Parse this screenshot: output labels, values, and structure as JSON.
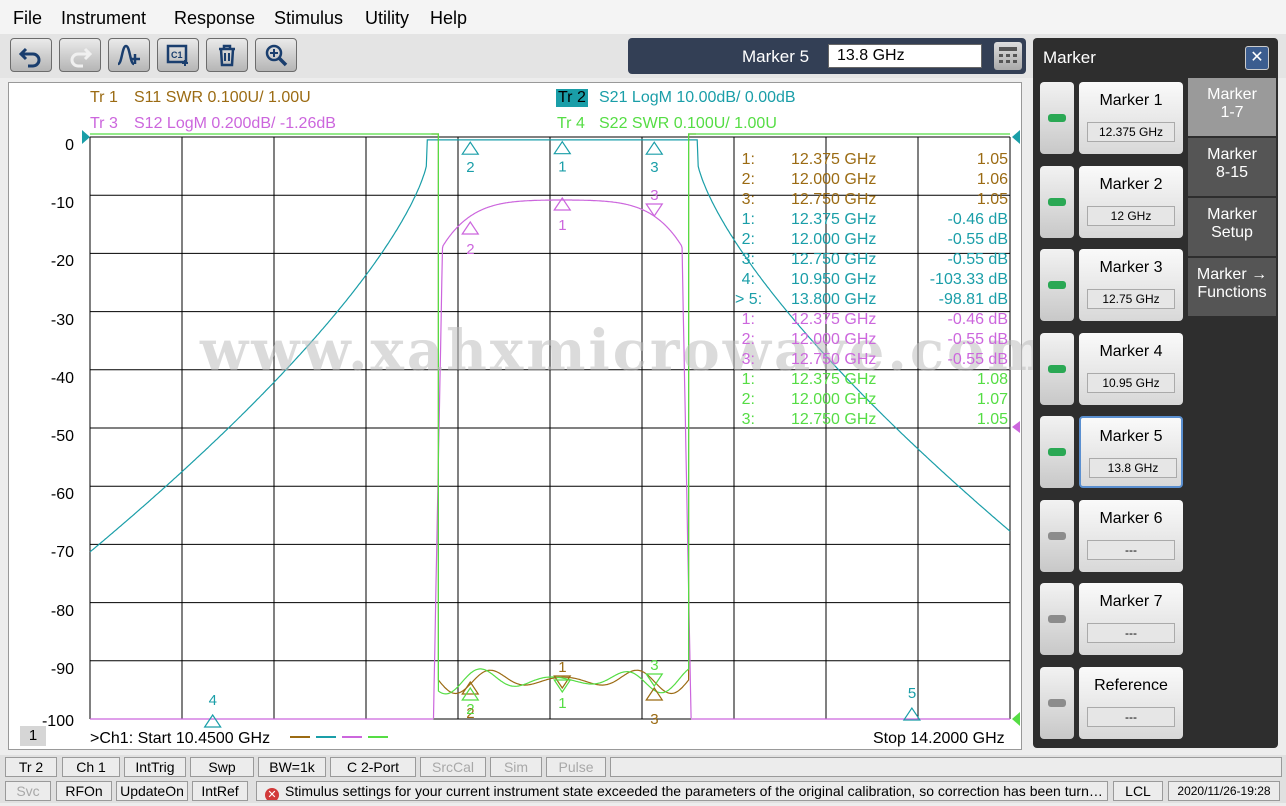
{
  "menu": [
    "File",
    "Instrument",
    "Response",
    "Stimulus",
    "Utility",
    "Help"
  ],
  "marker_entry": {
    "label": "Marker 5",
    "value": "13.8 GHz"
  },
  "traces": {
    "tr1": {
      "id": "Tr  1",
      "desc": "S11 SWR 0.100U/  1.00U",
      "color": "#9b6b13"
    },
    "tr2": {
      "id": "Tr  2",
      "desc": "S21 LogM 10.00dB/  0.00dB",
      "color": "#1a9ea8"
    },
    "tr3": {
      "id": "Tr  3",
      "desc": "S12 LogM 0.200dB/  -1.26dB",
      "color": "#cc66dd"
    },
    "tr4": {
      "id": "Tr  4",
      "desc": "S22 SWR 0.100U/  1.00U",
      "color": "#55dd44"
    }
  },
  "y_labels": [
    "0",
    "-10",
    "-20",
    "-30",
    "-40",
    "-50",
    "-60",
    "-70",
    "-80",
    "-90",
    "-100"
  ],
  "marker_table": [
    {
      "n": "1:",
      "f": "12.375  GHz",
      "v": "1.05",
      "trace": "tr1"
    },
    {
      "n": "2:",
      "f": "12.000  GHz",
      "v": "1.06",
      "trace": "tr1"
    },
    {
      "n": "3:",
      "f": "12.750  GHz",
      "v": "1.05",
      "trace": "tr1"
    },
    {
      "n": "1:",
      "f": "12.375  GHz",
      "v": "-0.46 dB",
      "trace": "tr2"
    },
    {
      "n": "2:",
      "f": "12.000  GHz",
      "v": "-0.55 dB",
      "trace": "tr2"
    },
    {
      "n": "3:",
      "f": "12.750  GHz",
      "v": "-0.55 dB",
      "trace": "tr2"
    },
    {
      "n": "4:",
      "f": "10.950  GHz",
      "v": "-103.33 dB",
      "trace": "tr2"
    },
    {
      "n": "> 5:",
      "f": "13.800  GHz",
      "v": "-98.81 dB",
      "trace": "tr2"
    },
    {
      "n": "1:",
      "f": "12.375  GHz",
      "v": "-0.46 dB",
      "trace": "tr3"
    },
    {
      "n": "2:",
      "f": "12.000  GHz",
      "v": "-0.55 dB",
      "trace": "tr3"
    },
    {
      "n": "3:",
      "f": "12.750  GHz",
      "v": "-0.55 dB",
      "trace": "tr3"
    },
    {
      "n": "1:",
      "f": "12.375  GHz",
      "v": "1.08",
      "trace": "tr4"
    },
    {
      "n": "2:",
      "f": "12.000  GHz",
      "v": "1.07",
      "trace": "tr4"
    },
    {
      "n": "3:",
      "f": "12.750  GHz",
      "v": "1.05",
      "trace": "tr4"
    }
  ],
  "watermark": "www.xahxmicrowave.com",
  "channel_badge": "1",
  "start": ">Ch1:  Start  10.4500 GHz",
  "stop": "Stop  14.2000 GHz",
  "panel_title": "Marker",
  "panel_close": "✕",
  "marker_buttons": [
    {
      "label": "Marker 1",
      "value": "12.375 GHz",
      "on": true
    },
    {
      "label": "Marker 2",
      "value": "12 GHz",
      "on": true
    },
    {
      "label": "Marker 3",
      "value": "12.75 GHz",
      "on": true
    },
    {
      "label": "Marker 4",
      "value": "10.95 GHz",
      "on": true
    },
    {
      "label": "Marker 5",
      "value": "13.8 GHz",
      "on": true
    },
    {
      "label": "Marker 6",
      "value": "---",
      "on": false
    },
    {
      "label": "Marker 7",
      "value": "---",
      "on": false
    },
    {
      "label": "Reference",
      "value": "---",
      "on": false
    }
  ],
  "tabs": [
    {
      "l1": "Marker",
      "l2": "1-7"
    },
    {
      "l1": "Marker",
      "l2": "8-15"
    },
    {
      "l1": "Marker",
      "l2": "Setup"
    },
    {
      "l1": "Marker →",
      "l2": "Functions"
    }
  ],
  "status_row1": [
    "Tr 2",
    "Ch 1",
    "IntTrig",
    "Swp",
    "BW=1k",
    "C  2-Port",
    "SrcCal",
    "Sim",
    "Pulse"
  ],
  "status_row2": [
    "Svc",
    "RFOn",
    "UpdateOn",
    "IntRef"
  ],
  "status_message": "Stimulus settings for your current instrument state exceeded the parameters of the original calibration, so correction has been turn…",
  "status_lcl": "LCL",
  "status_time": "2020/11/26-19:28",
  "x_axis": {
    "start_ghz": 10.45,
    "stop_ghz": 14.2
  },
  "s21_markers": [
    {
      "label": "1",
      "freq_ghz": 12.375,
      "db": -0.46
    },
    {
      "label": "2",
      "freq_ghz": 12.0,
      "db": -0.55
    },
    {
      "label": "3",
      "freq_ghz": 12.75,
      "db": -0.55
    },
    {
      "label": "4",
      "freq_ghz": 10.95,
      "db": -103.33
    },
    {
      "label": "5",
      "freq_ghz": 13.8,
      "db": -98.81
    }
  ]
}
